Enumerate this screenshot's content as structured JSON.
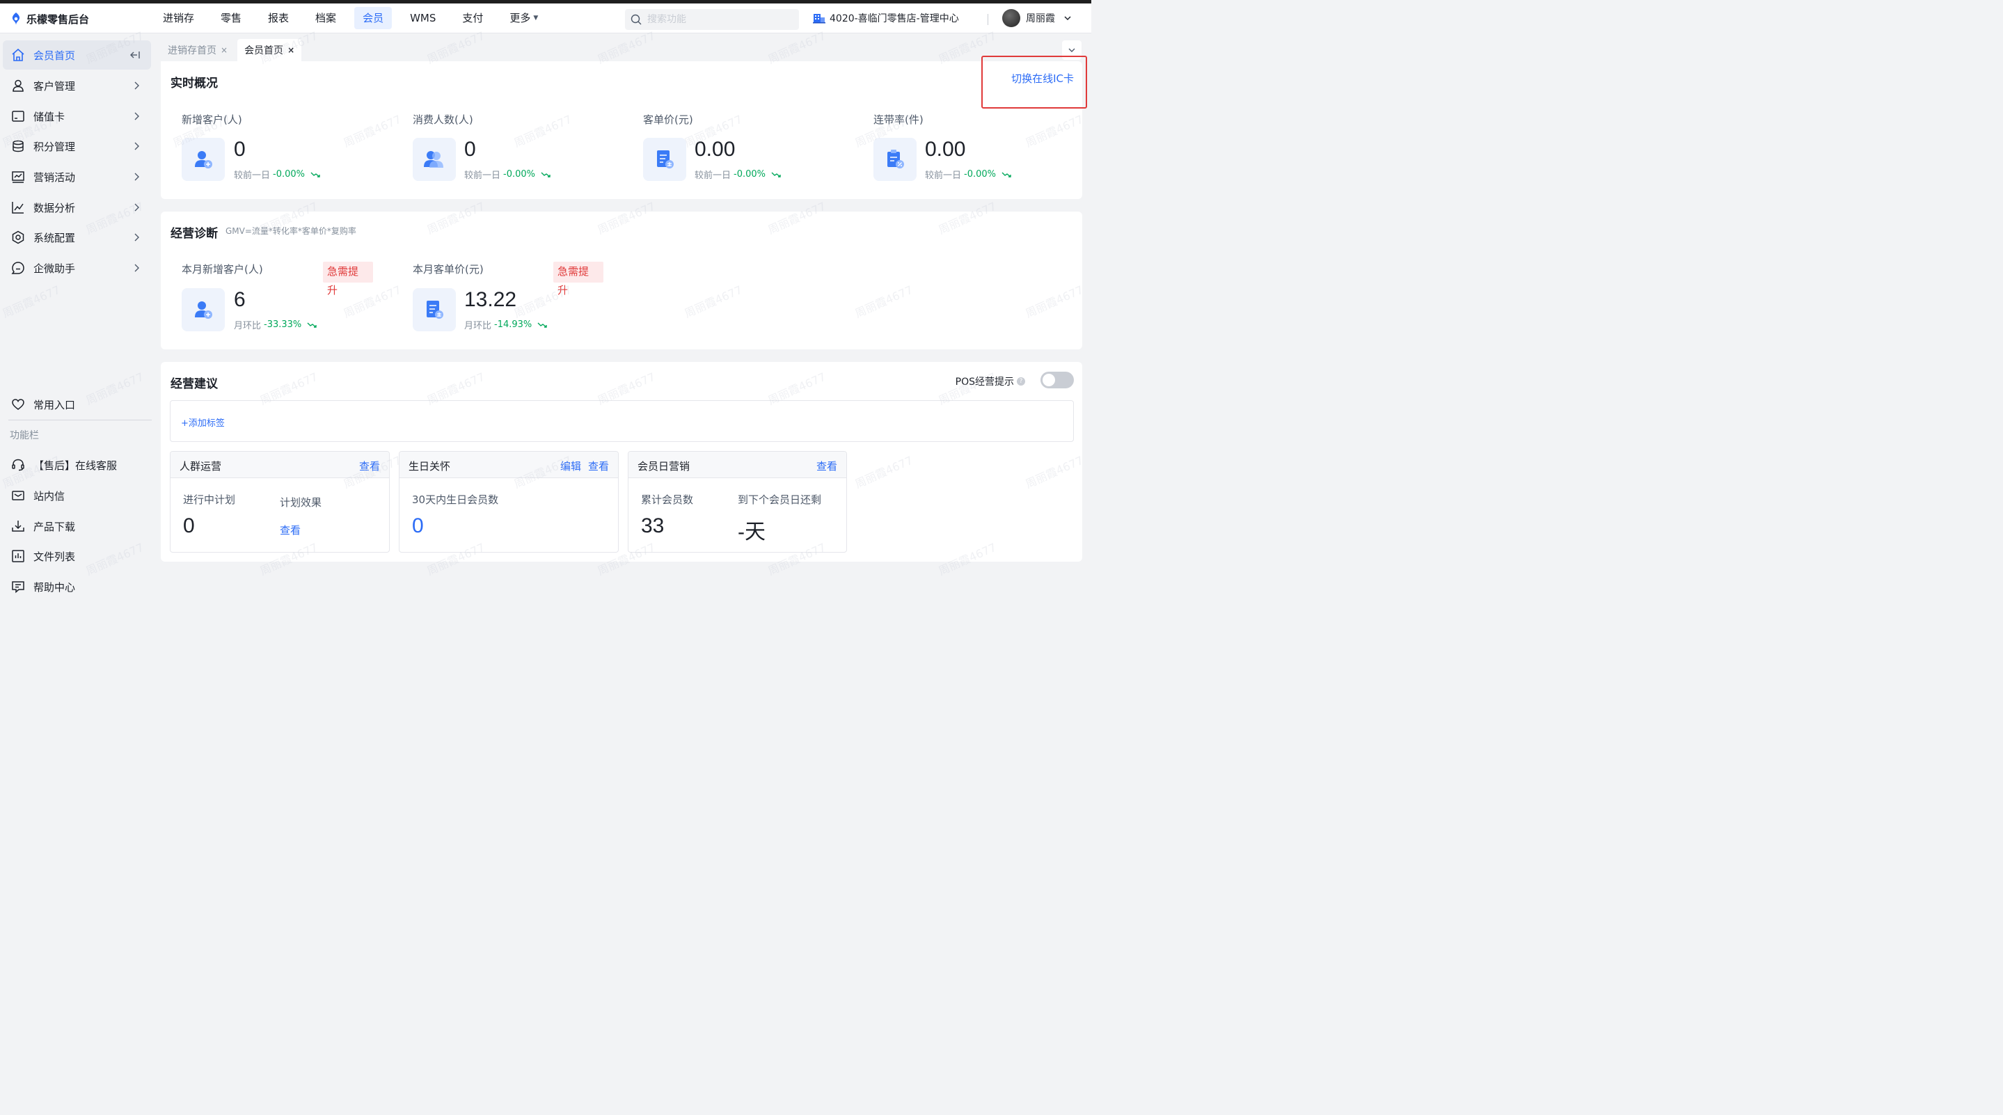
{
  "app": {
    "logo_text": "乐檬零售后台"
  },
  "nav": {
    "items": [
      "进销存",
      "零售",
      "报表",
      "档案",
      "会员",
      "WMS",
      "支付",
      "更多"
    ],
    "active_index": 4
  },
  "search": {
    "placeholder": "搜索功能"
  },
  "store": {
    "name": "4020-喜临门零售店-管理中心"
  },
  "user": {
    "name": "周丽霞"
  },
  "sidebar": {
    "items": [
      {
        "label": "会员首页",
        "icon": "home-icon",
        "active": true
      },
      {
        "label": "客户管理",
        "icon": "user-icon"
      },
      {
        "label": "储值卡",
        "icon": "card-icon"
      },
      {
        "label": "积分管理",
        "icon": "database-icon"
      },
      {
        "label": "营销活动",
        "icon": "chart-board-icon"
      },
      {
        "label": "数据分析",
        "icon": "line-chart-icon"
      },
      {
        "label": "系统配置",
        "icon": "settings-icon"
      },
      {
        "label": "企微助手",
        "icon": "chat-icon"
      }
    ],
    "favorites_label": "常用入口",
    "section_caption": "功能栏",
    "tools": [
      {
        "label": "【售后】在线客服",
        "icon": "headset-icon"
      },
      {
        "label": "站内信",
        "icon": "mail-icon"
      },
      {
        "label": "产品下载",
        "icon": "download-icon"
      },
      {
        "label": "文件列表",
        "icon": "file-list-icon"
      },
      {
        "label": "帮助中心",
        "icon": "help-icon"
      }
    ]
  },
  "tabs": [
    {
      "label": "进销存首页",
      "close": "×",
      "active": false
    },
    {
      "label": "会员首页",
      "close": "×",
      "active": true
    }
  ],
  "overview": {
    "title": "实时概况",
    "switch_link": "切换在线IC卡",
    "metrics": [
      {
        "label": "新增客户(人)",
        "value": "0",
        "cmp_label": "较前一日",
        "cmp_value": "-0.00%",
        "icon": "add-user-icon"
      },
      {
        "label": "消费人数(人)",
        "value": "0",
        "cmp_label": "较前一日",
        "cmp_value": "-0.00%",
        "icon": "users-icon"
      },
      {
        "label": "客单价(元)",
        "value": "0.00",
        "cmp_label": "较前一日",
        "cmp_value": "-0.00%",
        "icon": "receipt-icon"
      },
      {
        "label": "连带率(件)",
        "value": "0.00",
        "cmp_label": "较前一日",
        "cmp_value": "-0.00%",
        "icon": "clipboard-percent-icon"
      }
    ]
  },
  "diagnosis": {
    "title": "经营诊断",
    "formula": "GMV=流量*转化率*客单价*复购率",
    "metrics": [
      {
        "label": "本月新增客户(人)",
        "value": "6",
        "cmp_label": "月环比",
        "cmp_value": "-33.33%",
        "badge_line1": "急需提",
        "badge_line2": "升",
        "icon": "add-user-icon"
      },
      {
        "label": "本月客单价(元)",
        "value": "13.22",
        "cmp_label": "月环比",
        "cmp_value": "-14.93%",
        "badge_line1": "急需提",
        "badge_line2": "升",
        "icon": "receipt-icon"
      }
    ]
  },
  "suggestions": {
    "title": "经营建议",
    "pos_tip_label": "POS经营提示",
    "pos_tip_on": false,
    "add_tag": "+添加标签",
    "cards": [
      {
        "title": "人群运营",
        "actions": [
          "查看"
        ],
        "fields": [
          {
            "label": "进行中计划",
            "value": "0"
          },
          {
            "label": "计划效果",
            "link": "查看"
          }
        ]
      },
      {
        "title": "生日关怀",
        "actions": [
          "编辑",
          "查看"
        ],
        "fields": [
          {
            "label": "30天内生日会员数",
            "value": "0"
          }
        ]
      },
      {
        "title": "会员日营销",
        "actions": [
          "查看"
        ],
        "fields": [
          {
            "label": "累计会员数",
            "value": "33"
          },
          {
            "label": "到下个会员日还剩",
            "value": "-天"
          }
        ]
      }
    ]
  },
  "colors": {
    "accent": "#2c6cf6",
    "danger": "#e03a3a",
    "positive": "#00a85a"
  },
  "watermark": "周丽霞4677"
}
